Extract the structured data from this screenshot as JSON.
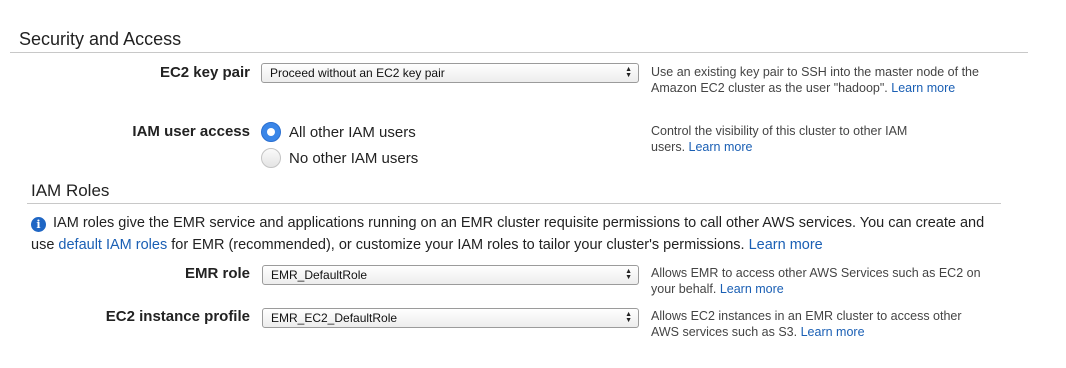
{
  "security": {
    "title": "Security and Access",
    "key_pair": {
      "label": "EC2 key pair",
      "selected": "Proceed without an EC2 key pair",
      "help": "Use an existing key pair to SSH into the master node of the Amazon EC2 cluster as the user \"hadoop\".",
      "learn_more": "Learn more"
    },
    "iam_access": {
      "label": "IAM user access",
      "options": [
        "All other IAM users",
        "No other IAM users"
      ],
      "selected_index": 0,
      "help": "Control the visibility of this cluster to other IAM users.",
      "learn_more": "Learn more"
    }
  },
  "iam_roles": {
    "title": "IAM Roles",
    "info_text_1": "IAM roles give the EMR service and applications running on an EMR cluster requisite permissions to call other AWS services. You can create and use",
    "info_link_1": "default IAM roles",
    "info_text_2": "for EMR (recommended), or customize your IAM roles to tailor your cluster's permissions.",
    "info_link_2": "Learn more",
    "emr_role": {
      "label": "EMR role",
      "selected": "EMR_DefaultRole",
      "help": "Allows EMR to access other AWS Services such as EC2 on your behalf.",
      "learn_more": "Learn more"
    },
    "instance_profile": {
      "label": "EC2 instance profile",
      "selected": "EMR_EC2_DefaultRole",
      "help": "Allows EC2 instances in an EMR cluster to access other AWS services such as S3.",
      "learn_more": "Learn more"
    }
  },
  "icons": {
    "select_arrows": "updown-chevron-icon",
    "info": "info-icon"
  },
  "colors": {
    "link": "#1a5fb4",
    "radio_selected": "#3a86e8",
    "info_icon": "#1f66c4"
  }
}
